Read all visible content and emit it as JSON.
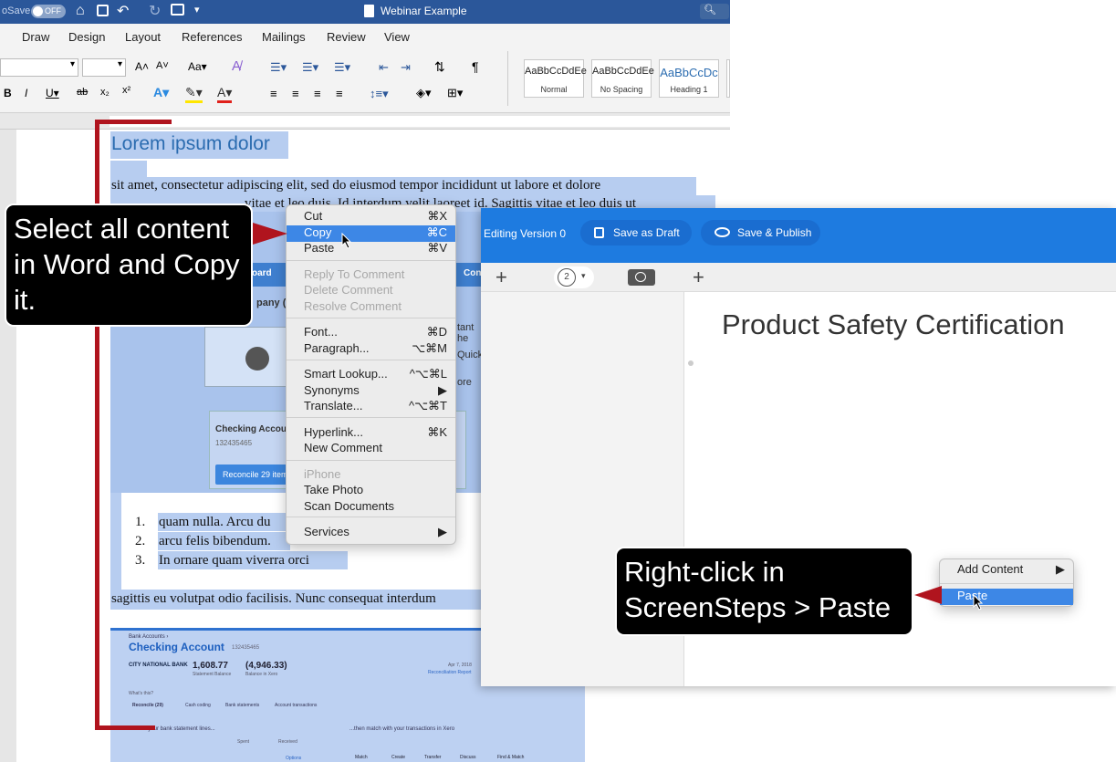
{
  "word": {
    "autosave_label": "oSave",
    "autosave_state": "OFF",
    "window_title": "Webinar Example",
    "tabs": [
      "Draw",
      "Design",
      "Layout",
      "References",
      "Mailings",
      "Review",
      "View"
    ],
    "styles": [
      {
        "sample": "AaBbCcDdEe",
        "name": "Normal"
      },
      {
        "sample": "AaBbCcDdEe",
        "name": "No Spacing"
      },
      {
        "sample": "AaBbCcDc",
        "name": "Heading 1"
      }
    ],
    "doc": {
      "heading": "Lorem ipsum dolor",
      "para1": "sit amet, consectetur adipiscing elit, sed do eiusmod tempor incididunt ut labore et dolore",
      "para1b": "vitae et leo duis. Id interdum velit laoreet id. Sagittis vitae et leo duis ut",
      "list": [
        {
          "num": "1.",
          "text": "quam nulla. Arcu du"
        },
        {
          "num": "2.",
          "text": "arcu felis bibendum."
        },
        {
          "num": "3.",
          "text": "In ornare quam viverra orci"
        }
      ],
      "para2": "sagittis eu volutpat odio facilisis. Nunc consequat interdum",
      "embed1": {
        "tab1": "oard",
        "tab2": "Conf",
        "company": "pany (",
        "side1": "tant he",
        "side2": "Quick",
        "side3": "ore",
        "card_title": "Checking Accoun",
        "card_num": "132435465",
        "card_button": "Reconcile 29 item"
      },
      "embed2": {
        "breadcrumb": "Bank Accounts ›",
        "account": "Checking Account",
        "account_num": "132435465",
        "bank": "CITY NATIONAL BANK",
        "stmt_balance": "1,608.77",
        "stmt_label": "Statement Balance",
        "xero_balance": "(4,946.33)",
        "xero_label": "Balance in Xero",
        "date": "Apr 7, 2018",
        "recon_report": "Reconciliation Report",
        "whats_this": "What's this?",
        "tabs": [
          "Reconcile (29)",
          "Cash coding",
          "Bank statements",
          "Account transactions"
        ],
        "left_text": "Review your bank statement lines...",
        "right_text": "...then match with your transactions in Xero",
        "spent": "Spent",
        "received": "Received",
        "buttons": [
          "Match",
          "Create",
          "Transfer",
          "Discuss",
          "Find & Match"
        ],
        "options": "Options"
      }
    }
  },
  "context_menu": {
    "items": [
      {
        "label": "Cut",
        "key": "⌘X",
        "state": "normal"
      },
      {
        "label": "Copy",
        "key": "⌘C",
        "state": "highlighted"
      },
      {
        "label": "Paste",
        "key": "⌘V",
        "state": "normal"
      },
      {
        "label": "Reply To Comment",
        "key": "",
        "state": "disabled"
      },
      {
        "label": "Delete Comment",
        "key": "",
        "state": "disabled"
      },
      {
        "label": "Resolve Comment",
        "key": "",
        "state": "disabled"
      },
      {
        "label": "Font...",
        "key": "⌘D",
        "state": "normal"
      },
      {
        "label": "Paragraph...",
        "key": "⌥⌘M",
        "state": "normal"
      },
      {
        "label": "Smart Lookup...",
        "key": "^⌥⌘L",
        "state": "normal"
      },
      {
        "label": "Synonyms",
        "key": "▶",
        "state": "normal"
      },
      {
        "label": "Translate...",
        "key": "^⌥⌘T",
        "state": "normal"
      },
      {
        "label": "Hyperlink...",
        "key": "⌘K",
        "state": "normal"
      },
      {
        "label": "New Comment",
        "key": "",
        "state": "normal"
      },
      {
        "label": "iPhone",
        "key": "",
        "state": "disabled"
      },
      {
        "label": "Take Photo",
        "key": "",
        "state": "normal"
      },
      {
        "label": "Scan Documents",
        "key": "",
        "state": "normal"
      },
      {
        "label": "Services",
        "key": "▶",
        "state": "normal"
      }
    ]
  },
  "screensteps": {
    "editing_version": "Editing Version 0",
    "save_draft": "Save as Draft",
    "save_publish": "Save & Publish",
    "step_number": "2",
    "title": "Product Safety Certification",
    "menu": {
      "add_content": "Add Content",
      "paste": "Paste"
    }
  },
  "callouts": {
    "word": "Select all content in Word and Copy it.",
    "screensteps": "Right-click in ScreenSteps > Paste"
  },
  "colors": {
    "word_blue": "#2b579a",
    "selection": "#b7cdf0",
    "ss_blue": "#1e7be0",
    "annotation_red": "#b0141e",
    "menu_highlight": "#3d87e6"
  }
}
